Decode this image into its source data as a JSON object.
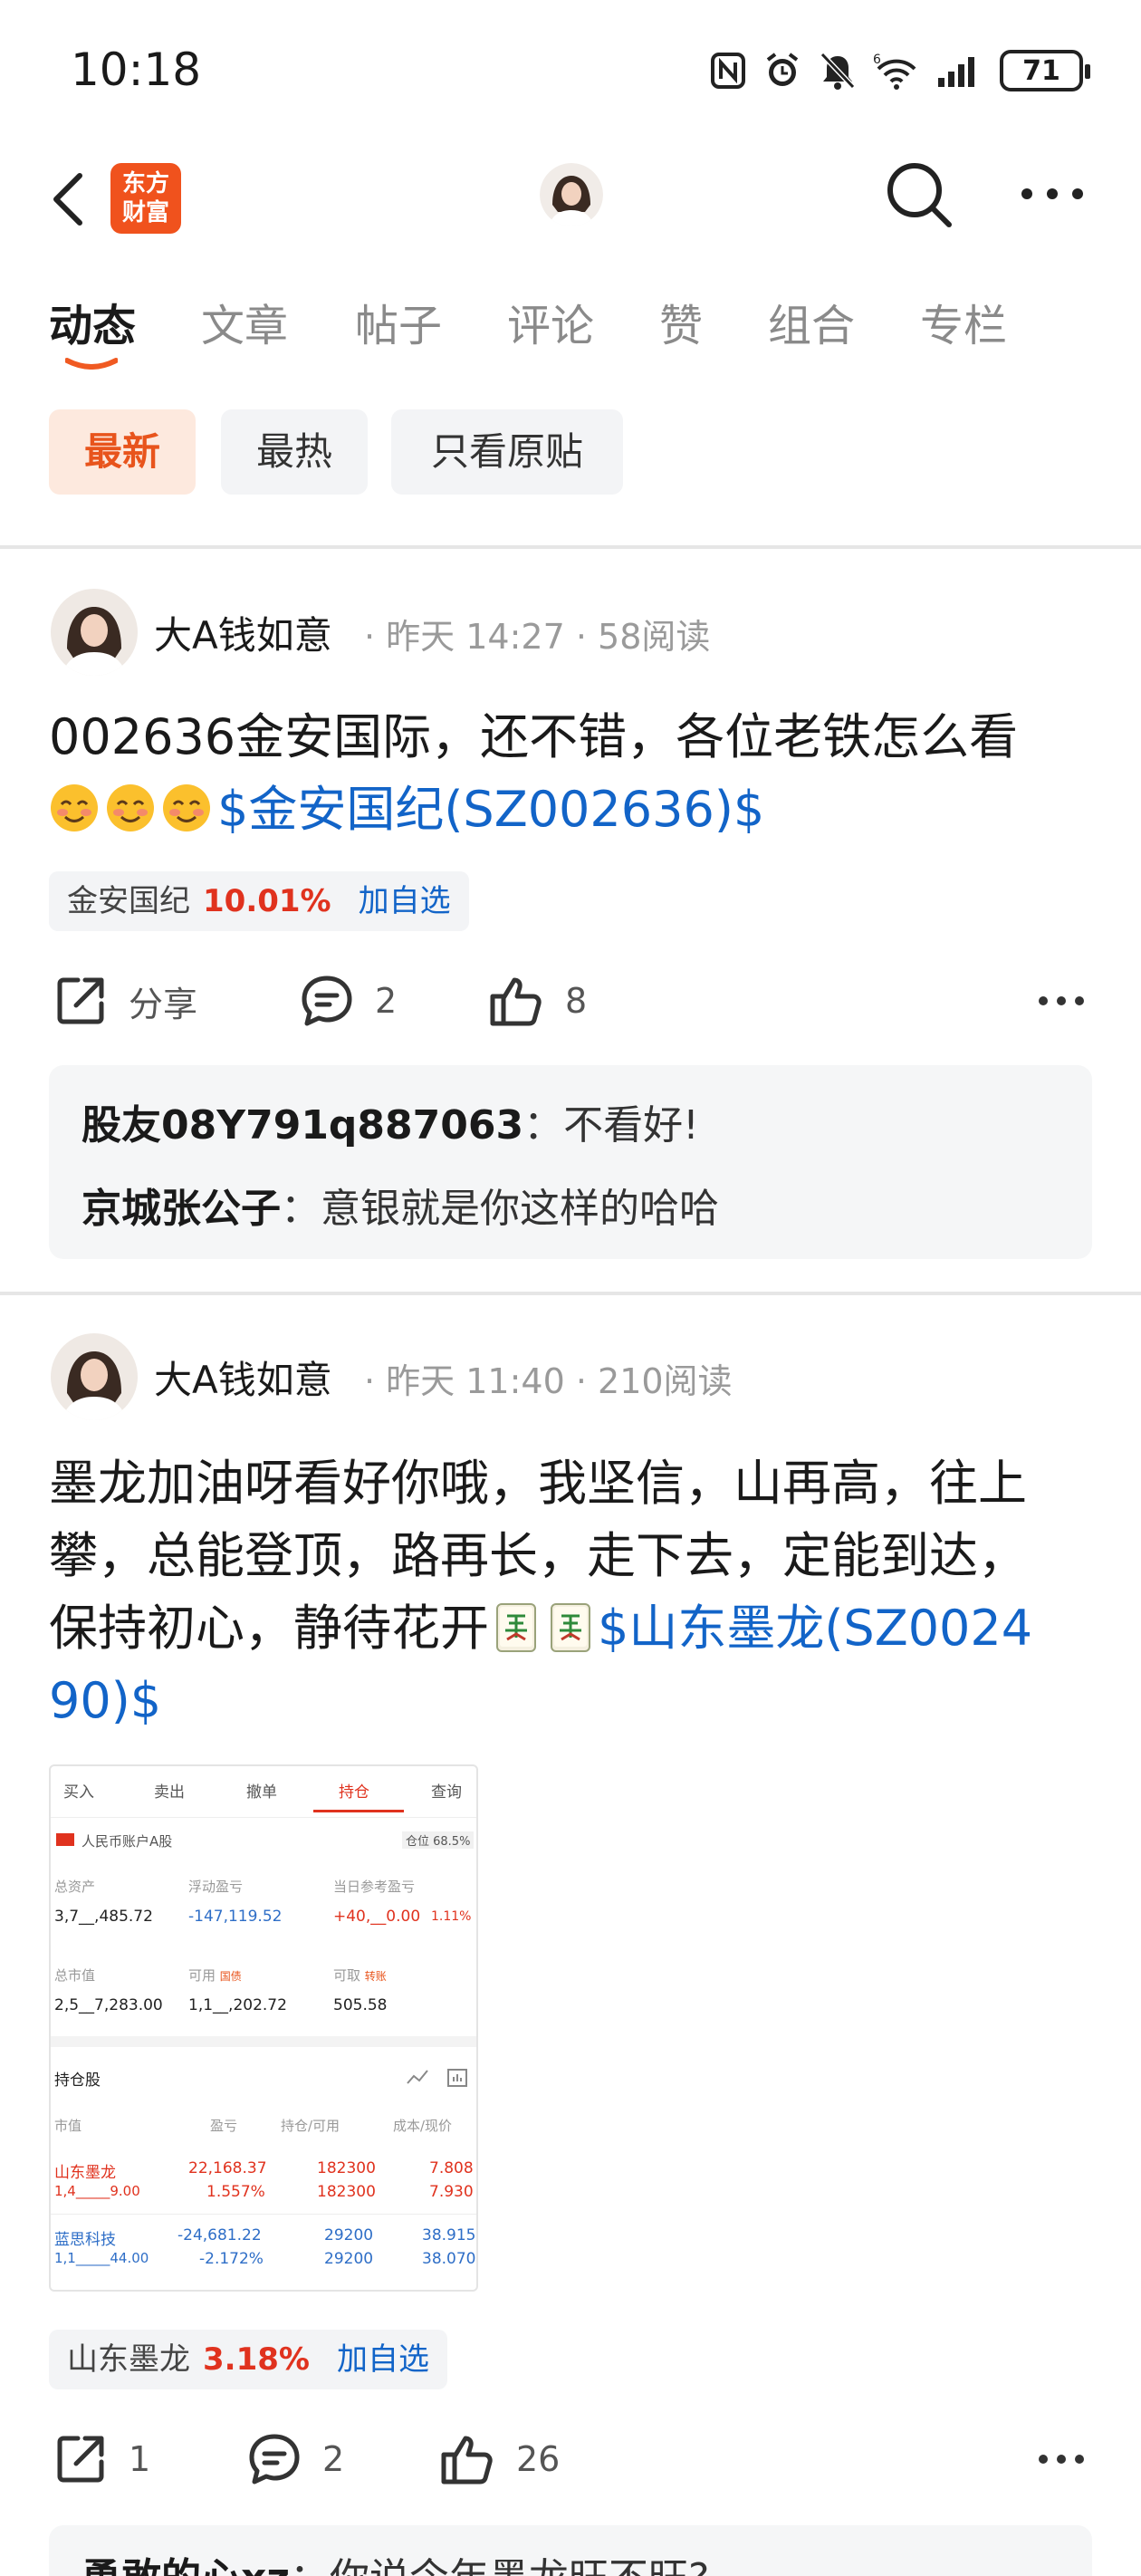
{
  "status_bar": {
    "time": "10:18",
    "battery": "71"
  },
  "header": {
    "logo_text_line1": "东方",
    "logo_text_line2": "财富"
  },
  "tabs": [
    "动态",
    "文章",
    "帖子",
    "评论",
    "赞",
    "组合",
    "专栏"
  ],
  "filters": [
    "最新",
    "最热",
    "只看原贴"
  ],
  "posts": [
    {
      "author": "大A钱如意",
      "time": "昨天 14:27",
      "reads": "58阅读",
      "text": "002636金安国际，还不错，各位老铁怎么看",
      "stock_tag": "$金安国纪(SZ002636)$",
      "chip": {
        "name": "金安国纪",
        "change": "10.01%",
        "add": "加自选"
      },
      "actions": {
        "share": "分享",
        "comments": "2",
        "likes": "8"
      },
      "comments": [
        {
          "user": "股友08Y791q887063",
          "text": "不看好!"
        },
        {
          "user": "京城张公子",
          "text": "意银就是你这样的哈哈"
        }
      ]
    },
    {
      "author": "大A钱如意",
      "time": "昨天 11:40",
      "reads": "210阅读",
      "text_line1": "墨龙加油呀看好你哦，我坚信，山再高，往上",
      "text_line2": "攀，总能登顶，路再长，走下去，定能到达，",
      "text_line3": "保持初心，静待花开",
      "stock_tag_line1": "$山东墨龙(SZ0024",
      "stock_tag_line2": "90)$",
      "chip": {
        "name": "山东墨龙",
        "change": "3.18%",
        "add": "加自选"
      },
      "actions": {
        "share": "1",
        "comments": "2",
        "likes": "26"
      },
      "comments": [
        {
          "user": "勇敢的心xz",
          "text": "你说今年墨龙旺不旺?"
        }
      ]
    }
  ],
  "thumbnail": {
    "tabs": [
      "买入",
      "卖出",
      "撤单",
      "持仓",
      "查询"
    ],
    "account": "人民币账户A股",
    "position_ratio": "仓位 68.5%",
    "total_assets_label": "总资产",
    "total_assets": "3,7__,485.72",
    "float_pl_label": "浮动盈亏",
    "float_pl": "-147,119.52",
    "day_pl_label": "当日参考盈亏",
    "day_pl": "+40,__0.00",
    "day_pl_pct": "1.11%",
    "market_value_label": "总市值",
    "market_value": "2,5__7,283.00",
    "available_label": "可用",
    "available_tag": "国债",
    "available": "1,1__,202.72",
    "withdrawable_label": "可取",
    "withdrawable_tag": "转账",
    "withdrawable": "505.58",
    "holdings_title": "持仓股",
    "cols": [
      "市值",
      "盈亏",
      "持仓/可用",
      "成本/现价"
    ],
    "rows": [
      {
        "name": "山东墨龙",
        "mv": "1,4_____9.00",
        "pl": "22,168.37",
        "plpct": "1.557%",
        "qty": "182300",
        "avail": "182300",
        "cost": "7.808",
        "price": "7.930"
      },
      {
        "name": "蓝思科技",
        "mv": "1,1_____44.00",
        "pl": "-24,681.22",
        "plpct": "-2.172%",
        "qty": "29200",
        "avail": "29200",
        "cost": "38.915",
        "price": "38.070"
      }
    ]
  }
}
